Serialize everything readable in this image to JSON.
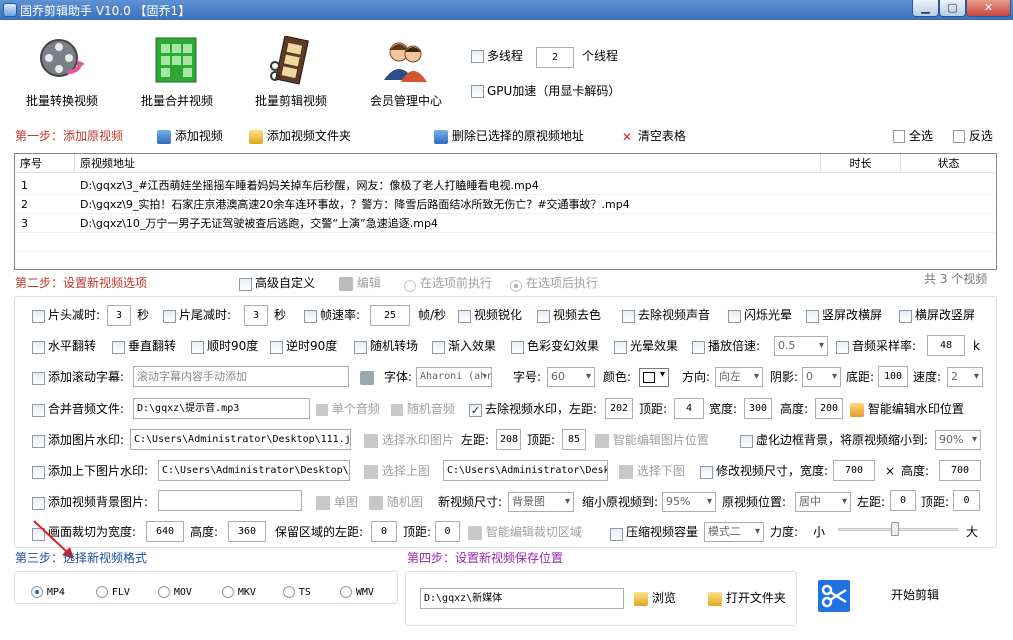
{
  "window": {
    "title": "固乔剪辑助手 V10.0  【固乔1】"
  },
  "toolbar": {
    "batch_convert": "批量转换视频",
    "batch_merge": "批量合并视频",
    "batch_edit": "批量剪辑视频",
    "member_center": "会员管理中心",
    "multithread": "多线程",
    "thread_count": "2",
    "thread_unit": "个线程",
    "gpu": "GPU加速（用显卡解码）"
  },
  "step1": {
    "title": "第一步：添加原视频",
    "add_video": "添加视频",
    "add_folder": "添加视频文件夹",
    "delete_selected": "删除已选择的原视频地址",
    "clear_table": "清空表格",
    "select_all": "全选",
    "invert": "反选"
  },
  "table": {
    "headers": [
      "序号",
      "原视频地址",
      "时长",
      "状态"
    ],
    "rows": [
      {
        "idx": "1",
        "path": "D:\\gqxz\\3_#江西萌娃坐摇摇车睡着妈妈关掉车后秒醒，网友：像极了老人打瞌睡看电视.mp4"
      },
      {
        "idx": "2",
        "path": "D:\\gqxz\\9_实拍！石家庄京港澳高速20余车连环事故，？警方：降雪后路面结冰所致无伤亡？#交通事故？.mp4"
      },
      {
        "idx": "3",
        "path": "D:\\gqxz\\10_万宁一男子无证驾驶被查后逃跑，交警“上演”急速追逐.mp4"
      }
    ]
  },
  "step2": {
    "title": "第二步：设置新视频选项",
    "advanced": "高级自定义",
    "edit": "编辑",
    "before": "在选项前执行",
    "after": "在选项后执行",
    "count": "共 3 个视频"
  },
  "opts": {
    "head_cut": "片头减时:",
    "head_val": "3",
    "sec1": "秒",
    "tail_cut": "片尾减时:",
    "tail_val": "3",
    "sec2": "秒",
    "fps": "帧速率:",
    "fps_val": "25",
    "fps_unit": "帧/秒",
    "sharpen": "视频锐化",
    "decolor": "视频去色",
    "mute": "去除视频声音",
    "flash": "闪烁光晕",
    "v2h": "竖屏改横屏",
    "h2v": "横屏改竖屏",
    "hflip": "水平翻转",
    "vflip": "垂直翻转",
    "cw90": "顺时90度",
    "ccw90": "逆时90度",
    "rand_trans": "随机转场",
    "fade_in": "渐入效果",
    "color_fx": "色彩变幻效果",
    "halo": "光晕效果",
    "speed": "播放倍速:",
    "speed_val": "0.5",
    "samplerate": "音频采样率:",
    "sr_val": "48",
    "sr_unit": "k",
    "scroll": "添加滚动字幕:",
    "scroll_ph": "滚动字幕内容手动添加",
    "font": "字体:",
    "font_val": "Aharoni (ahr",
    "fontsize": "字号:",
    "fontsize_val": "60",
    "color": "颜色:",
    "direction": "方向:",
    "direction_val": "向左",
    "shadow": "阴影:",
    "shadow_val": "0",
    "bottom": "底距:",
    "bottom_val": "100",
    "speed2": "速度:",
    "speed2_val": "2",
    "merge_audio": "合并音频文件:",
    "merge_audio_val": "D:\\gqxz\\提示音.mp3",
    "single_audio": "单个音频",
    "random_audio": "随机音频",
    "remove_wm": "去除视频水印，左距:",
    "wm_left": "202",
    "wm_top_l": "顶距:",
    "wm_top": "4",
    "wm_w_l": "宽度:",
    "wm_w": "300",
    "wm_h_l": "高度:",
    "wm_h": "200",
    "smart_wm": "智能编辑水印位置",
    "img_wm": "添加图片水印:",
    "img_wm_val": "C:\\Users\\Administrator\\Desktop\\111.j",
    "choose_wm": "选择水印图片",
    "img_left_l": "左距:",
    "img_left": "208",
    "img_top_l": "顶距:",
    "img_top": "85",
    "smart_img": "智能编辑图片位置",
    "blur_bg": "虚化边框背景，将原视频缩小到:",
    "blur_val": "90%",
    "ud_wm": "添加上下图片水印:",
    "ud_top_val": "C:\\Users\\Administrator\\Desktop\\i",
    "choose_top": "选择上图",
    "ud_bot_val": "C:\\Users\\Administrator\\Desk",
    "choose_bot": "选择下图",
    "resize": "修改视频尺寸，宽度:",
    "resize_w": "700",
    "x": "×",
    "resize_h_l": "高度:",
    "resize_h": "700",
    "bg_img": "添加视频背景图片:",
    "single_img": "单图",
    "random_img": "随机图",
    "new_size": "新视频尺寸:",
    "new_size_val": "背景图",
    "shrink": "缩小原视频到:",
    "shrink_val": "95%",
    "orig_pos": "原视频位置:",
    "orig_pos_val": "居中",
    "left_l": "左距:",
    "left_v": "0",
    "top_l": "顶距:",
    "top_v": "0",
    "crop": "画面裁切为宽度:",
    "crop_w": "640",
    "crop_h_l": "高度:",
    "crop_h": "360",
    "keep_left": "保留区域的左距:",
    "keep_left_v": "0",
    "keep_top_l": "顶距:",
    "keep_top_v": "0",
    "smart_crop": "智能编辑裁切区域",
    "compress": "压缩视频容量",
    "mode_val": "模式二",
    "strength": "力度:",
    "small": "小",
    "large": "大"
  },
  "step3": {
    "title": "第三步：选择新视频格式",
    "formats": [
      "MP4",
      "FLV",
      "MOV",
      "MKV",
      "TS",
      "WMV"
    ]
  },
  "step4": {
    "title": "第四步：设置新视频保存位置",
    "path": "D:\\gqxz\\新媒体",
    "browse": "浏览",
    "open_folder": "打开文件夹",
    "start": "开始剪辑"
  },
  "colors": {
    "step_red": "#c0392b",
    "step_purple": "#9b27af",
    "step_blue": "#1a4fa0",
    "accent": "#1e73e0"
  }
}
